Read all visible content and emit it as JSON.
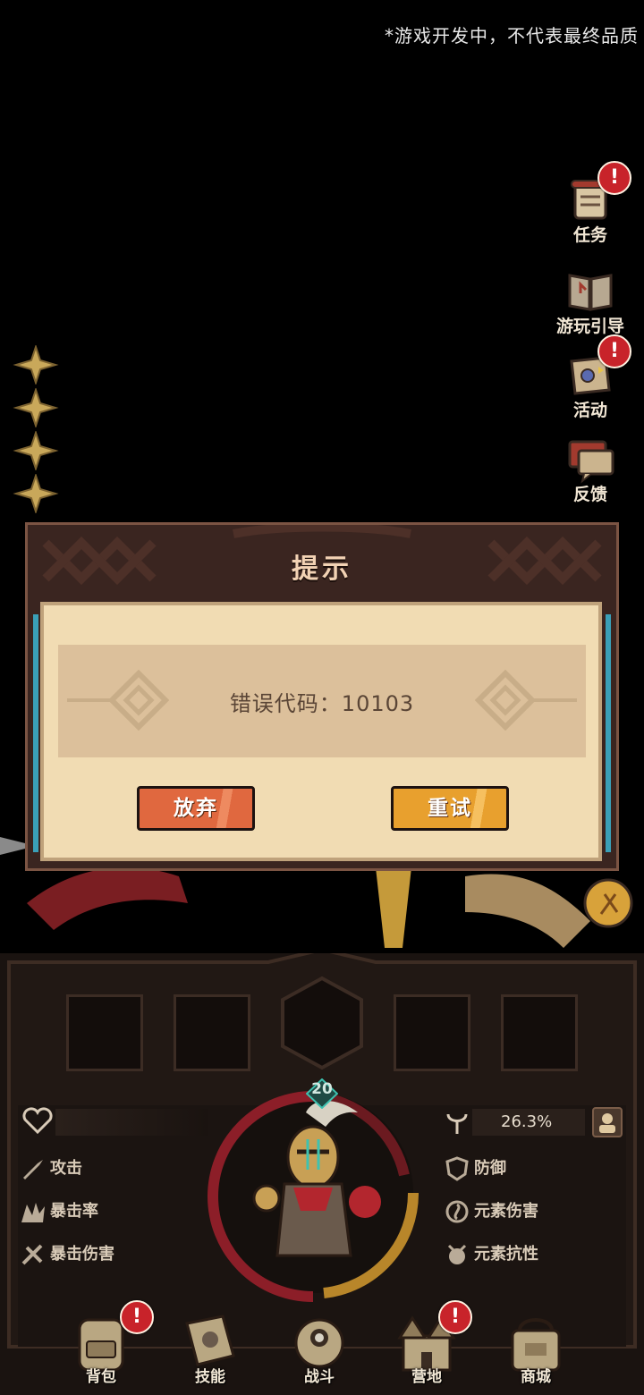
{
  "notice": "*游戏开发中，不代表最终品质",
  "right_menu": [
    {
      "label": "任务",
      "icon": "scroll-quest-icon",
      "badge": "!"
    },
    {
      "label": "游玩引导",
      "icon": "guide-book-icon",
      "badge": ""
    },
    {
      "label": "活动",
      "icon": "event-map-icon",
      "badge": "!"
    },
    {
      "label": "反馈",
      "icon": "feedback-chat-icon",
      "badge": ""
    }
  ],
  "dialog": {
    "title": "提示",
    "message": "错误代码：10103",
    "abandon_label": "放弃",
    "retry_label": "重试"
  },
  "hero": {
    "level": "20",
    "percent": "26.3%"
  },
  "stats_left": [
    {
      "label": "攻击",
      "icon": "sword-attack-icon"
    },
    {
      "label": "暴击率",
      "icon": "crit-rate-icon"
    },
    {
      "label": "暴击伤害",
      "icon": "crit-damage-icon"
    }
  ],
  "stats_right": [
    {
      "label": "防御",
      "icon": "shield-defense-icon"
    },
    {
      "label": "元素伤害",
      "icon": "element-damage-icon"
    },
    {
      "label": "元素抗性",
      "icon": "element-resist-icon"
    }
  ],
  "bottom_nav": [
    {
      "label": "背包",
      "icon": "backpack-icon",
      "badge": "!"
    },
    {
      "label": "技能",
      "icon": "skill-book-icon",
      "badge": ""
    },
    {
      "label": "战斗",
      "icon": "battle-icon",
      "badge": ""
    },
    {
      "label": "营地",
      "icon": "camp-castle-icon",
      "badge": "!"
    },
    {
      "label": "商城",
      "icon": "shop-icon",
      "badge": ""
    }
  ],
  "colors": {
    "accent_teal": "#3aa0b8",
    "badge_red": "#c8232a",
    "abandon_orange": "#e0683f",
    "retry_gold": "#e8a02e",
    "hp_ring_red": "#8c1e28",
    "xp_ring_gold": "#b8862a"
  }
}
